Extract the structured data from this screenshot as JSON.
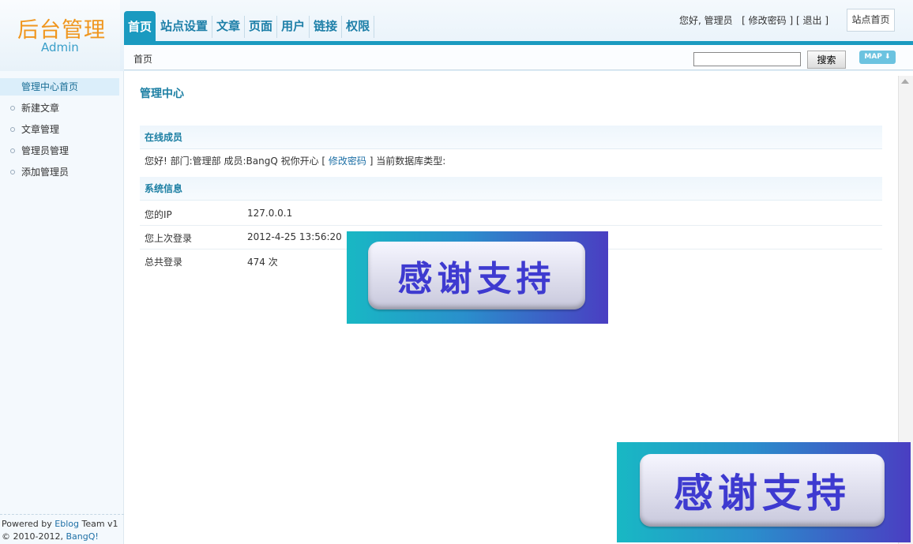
{
  "logo": {
    "title": "后台管理",
    "subtitle": "Admin"
  },
  "nav": {
    "items": [
      "首页",
      "站点设置",
      "文章",
      "页面",
      "用户",
      "链接",
      "权限"
    ]
  },
  "user_links": {
    "greeting": "您好, 管理员",
    "open": "[",
    "change_password": "修改密码",
    "sep": "] [",
    "logout": "退出",
    "close": "]"
  },
  "site_home": "站点首页",
  "breadcrumb": "首页",
  "search": {
    "value": "",
    "button": "搜索"
  },
  "map_button": "MAP ⬇",
  "sidebar": {
    "items": [
      "管理中心首页",
      "新建文章",
      "文章管理",
      "管理员管理",
      "添加管理员"
    ],
    "footer": {
      "powered_prefix": "Powered by ",
      "powered_link": "Eblog",
      "powered_suffix": " Team v1",
      "copyright_prefix": "© 2010-2012, ",
      "copyright_link": "BangQ!"
    }
  },
  "main": {
    "title": "管理中心",
    "online": {
      "heading": "在线成员",
      "text_prefix": "您好! 部门:管理部  成员:BangQ 祝你开心 [ ",
      "change_password": "修改密码",
      "text_suffix": " ] 当前数据库类型:"
    },
    "system": {
      "heading": "系统信息",
      "rows": [
        {
          "label": "您的IP",
          "value": "127.0.0.1"
        },
        {
          "label": "您上次登录",
          "value": "2012-4-25 13:56:20"
        },
        {
          "label": "总共登录",
          "value": "474 次"
        }
      ]
    }
  },
  "banners": {
    "text": "感谢支持"
  }
}
